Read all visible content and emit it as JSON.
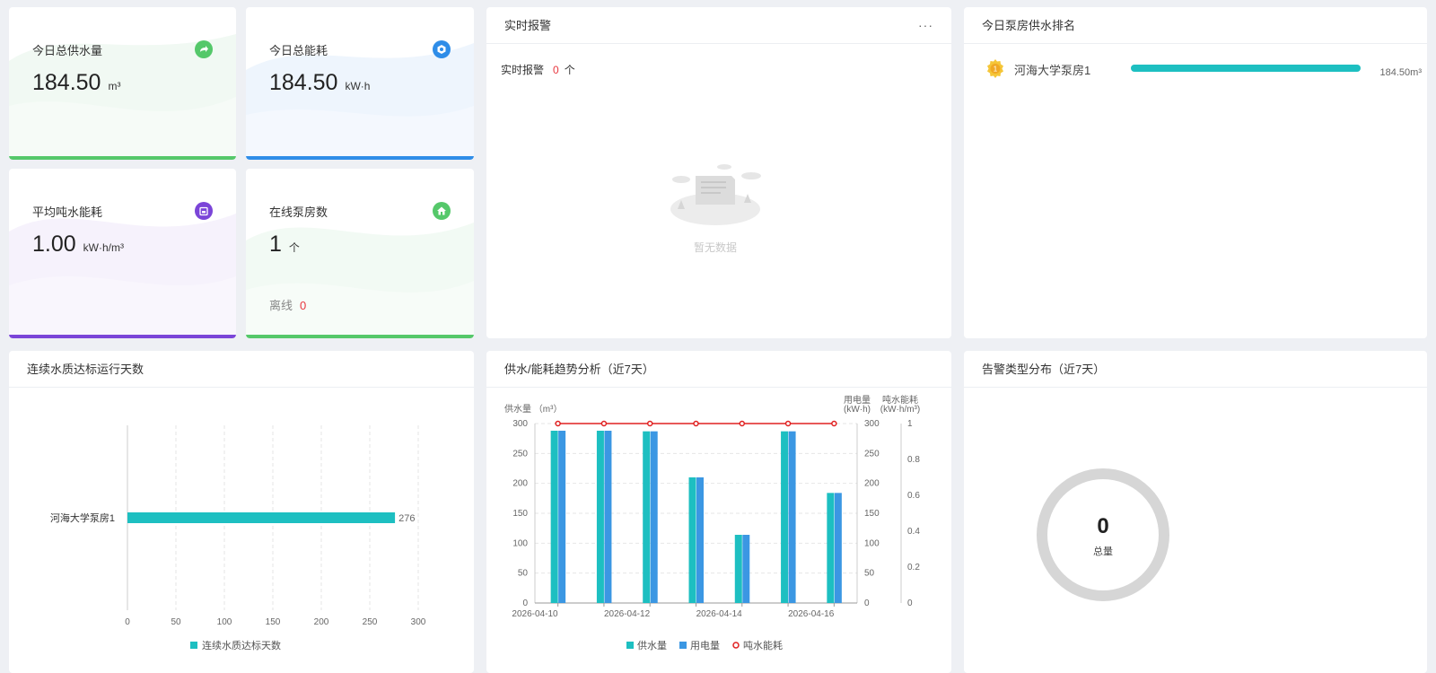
{
  "stats": [
    {
      "title": "今日总供水量",
      "value": "184.50",
      "unit": "m³",
      "accent": "#55c86a",
      "icon": "share-arrow-icon"
    },
    {
      "title": "今日总能耗",
      "value": "184.50",
      "unit": "kW·h",
      "accent": "#2f8de8",
      "icon": "energy-icon"
    },
    {
      "title": "平均吨水能耗",
      "value": "1.00",
      "unit": "kW·h/m³",
      "accent": "#7b45d8",
      "icon": "calendar-icon"
    },
    {
      "title": "在线泵房数",
      "value": "1",
      "unit": "个",
      "accent": "#55c86a",
      "icon": "home-icon",
      "offline_label": "离线",
      "offline_value": "0"
    }
  ],
  "alarm_panel": {
    "title": "实时报警",
    "more": "···",
    "line_label": "实时报警",
    "count": "0",
    "count_unit": "个",
    "empty_text": "暂无数据"
  },
  "rank_panel": {
    "title": "今日泵房供水排名",
    "items": [
      {
        "name": "河海大学泵房1",
        "value_label": "184.50m³",
        "fraction": 1.0
      }
    ]
  },
  "quality_panel": {
    "title": "连续水质达标运行天数"
  },
  "trend_panel": {
    "title": "供水/能耗趋势分析（近7天）"
  },
  "alarm_type_panel": {
    "title": "告警类型分布（近7天）",
    "total_value": "0",
    "total_label": "总量"
  },
  "chart_data": [
    {
      "type": "bar",
      "orientation": "horizontal",
      "categories": [
        "河海大学泵房1"
      ],
      "series": [
        {
          "name": "连续水质达标天数",
          "values": [
            276
          ],
          "color": "#1dbfc1"
        }
      ],
      "xlim": [
        0,
        300
      ],
      "xticks": [
        "0",
        "50",
        "100",
        "150",
        "200",
        "250",
        "300"
      ],
      "data_labels": [
        "276"
      ],
      "legend": "bottom"
    },
    {
      "type": "bar",
      "categories": [
        "2026-04-10",
        "2026-04-11",
        "2026-04-12",
        "2026-04-13",
        "2026-04-14",
        "2026-04-15",
        "2026-04-16"
      ],
      "x_tick_labels": [
        "2026-04-10",
        "2026-04-12",
        "2026-04-14",
        "2026-04-16"
      ],
      "series": [
        {
          "name": "供水量",
          "type": "bar",
          "values": [
            288,
            288,
            287,
            210,
            114,
            287,
            184
          ],
          "color": "#1dbfc1"
        },
        {
          "name": "用电量",
          "type": "bar",
          "values": [
            288,
            288,
            287,
            210,
            114,
            287,
            184
          ],
          "color": "#3b97e3"
        },
        {
          "name": "吨水能耗",
          "type": "line",
          "values": [
            1,
            1,
            1,
            1,
            1,
            1,
            1
          ],
          "color": "#e02020"
        }
      ],
      "y_left": {
        "label": "供水量 （m³）",
        "ylim": [
          0,
          300
        ],
        "ticks": [
          "0",
          "50",
          "100",
          "150",
          "200",
          "250",
          "300"
        ]
      },
      "y_right1": {
        "label1": "用电量",
        "label2": "(kW·h)",
        "ylim": [
          0,
          300
        ],
        "ticks": [
          "0",
          "50",
          "100",
          "150",
          "200",
          "250",
          "300"
        ]
      },
      "y_right2": {
        "label1": "吨水能耗",
        "label2": "(kW·h/m³)",
        "ylim": [
          0,
          1
        ],
        "ticks": [
          "0",
          "0.2",
          "0.4",
          "0.6",
          "0.8",
          "1"
        ]
      },
      "legend": "bottom",
      "grid": true
    },
    {
      "type": "pie",
      "variant": "donut",
      "values": [],
      "center_value": "0",
      "center_label": "总量"
    }
  ]
}
